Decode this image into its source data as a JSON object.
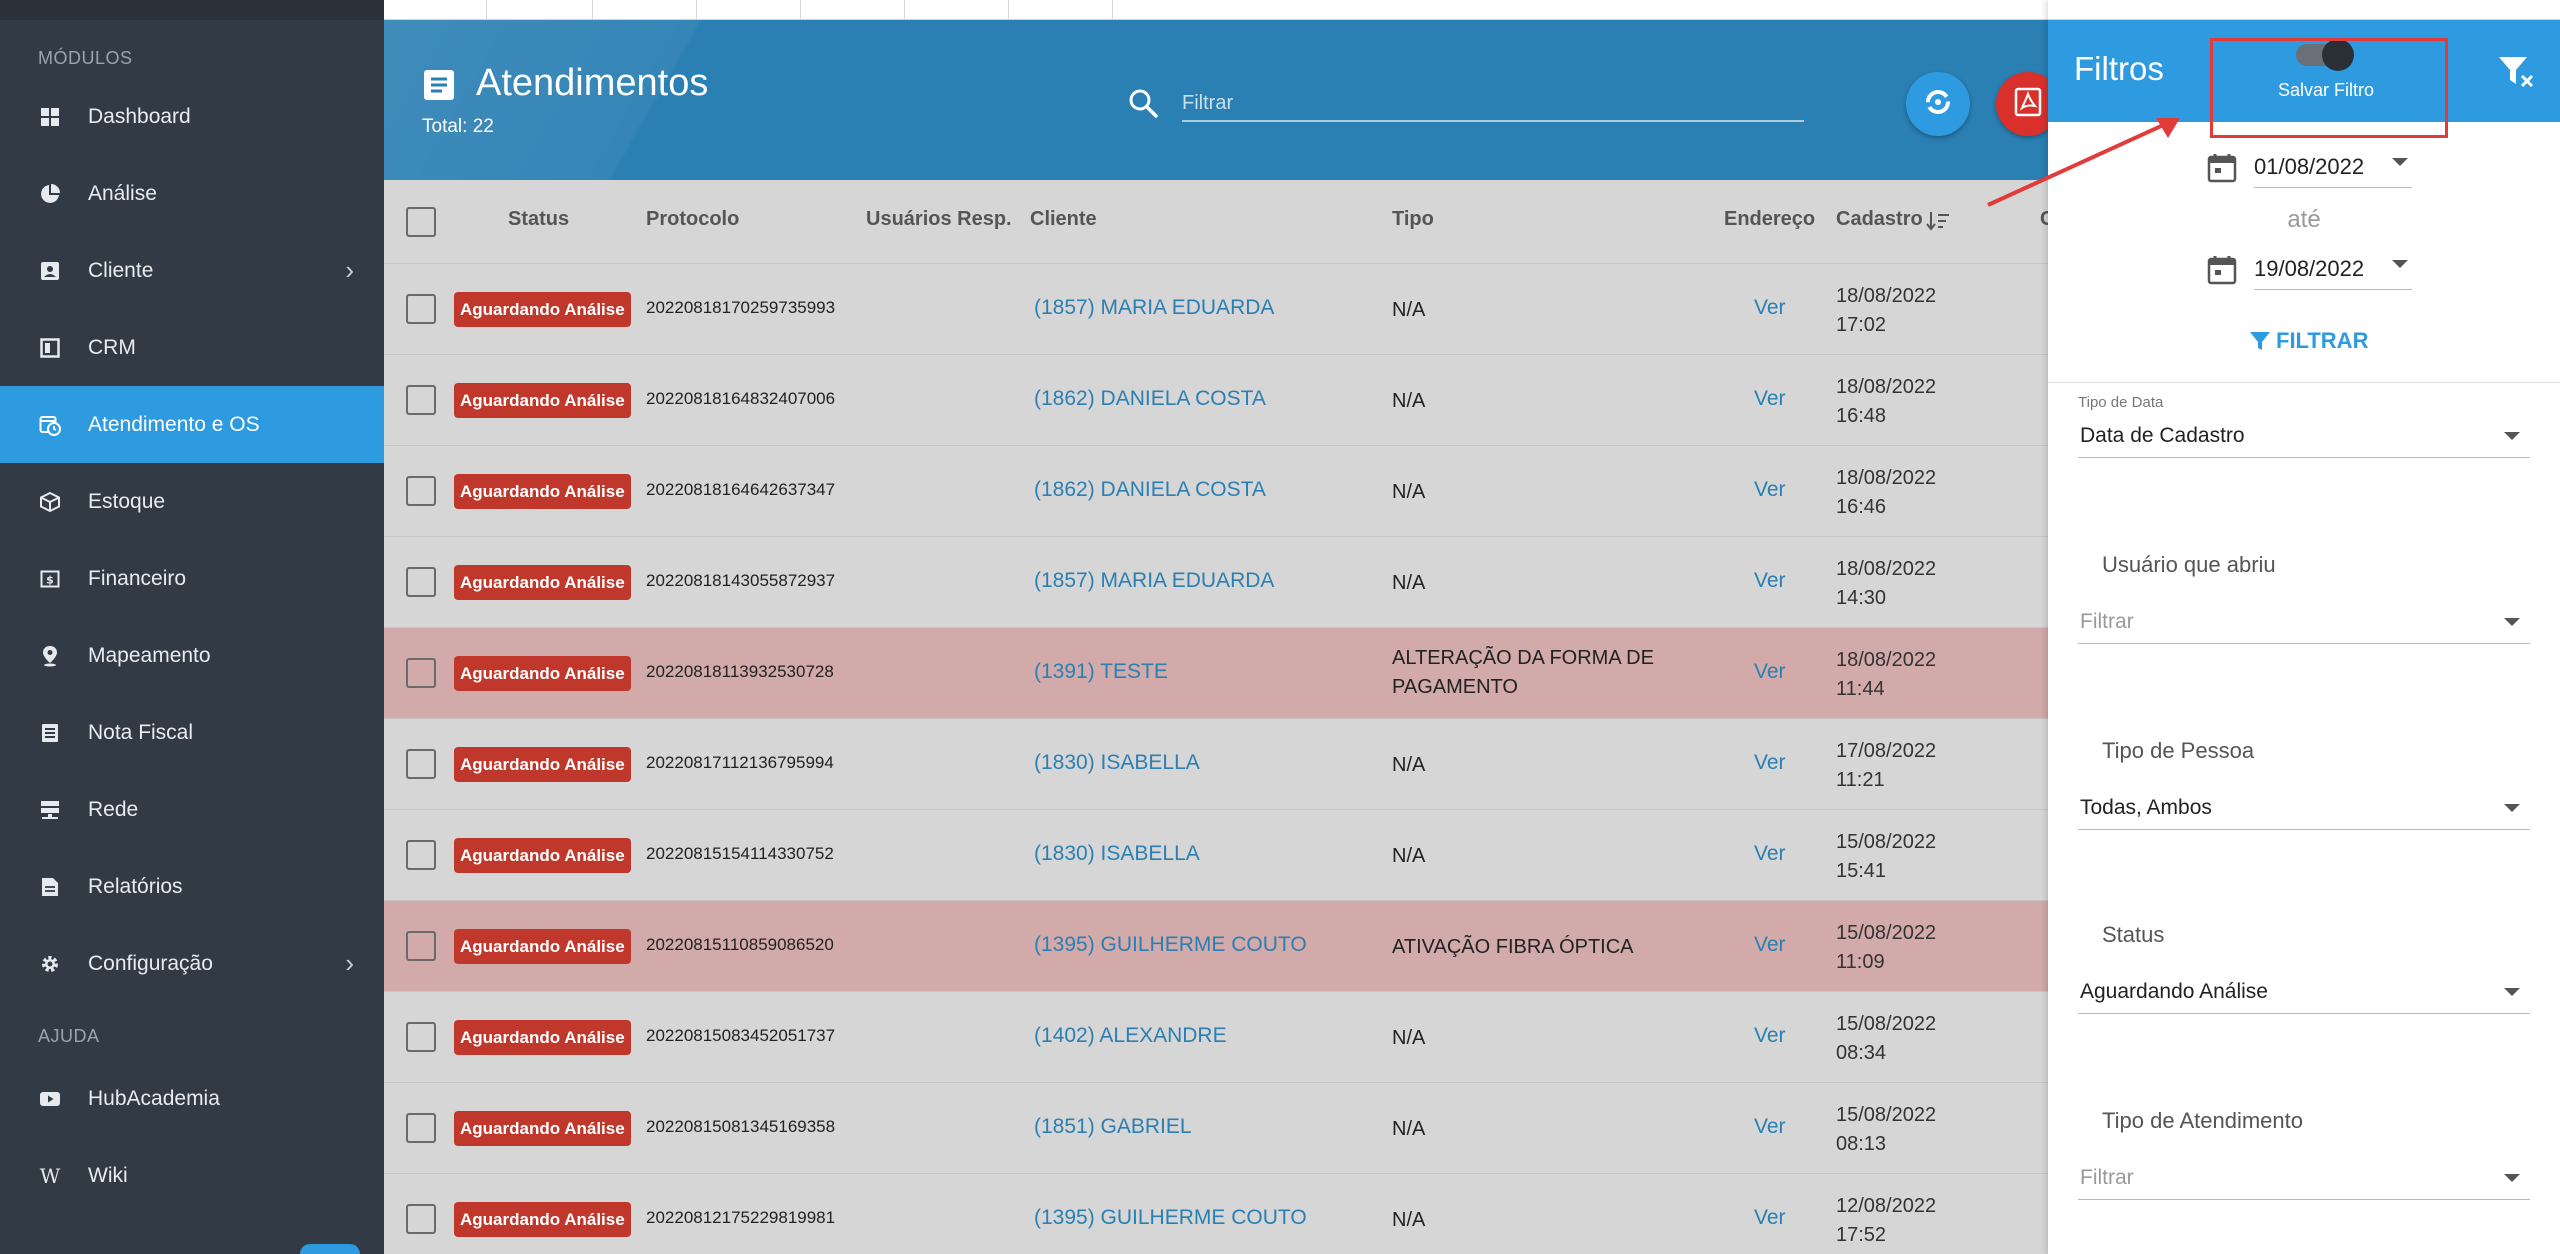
{
  "sidebar": {
    "section_modules": "MÓDULOS",
    "section_help": "AJUDA",
    "items": [
      {
        "label": "Dashboard",
        "icon": "dashboard-icon"
      },
      {
        "label": "Análise",
        "icon": "pie-chart-icon"
      },
      {
        "label": "Cliente",
        "icon": "contact-card-icon",
        "has_submenu": true
      },
      {
        "label": "CRM",
        "icon": "crm-board-icon"
      },
      {
        "label": "Atendimento e OS",
        "icon": "calendar-clock-icon",
        "active": true
      },
      {
        "label": "Estoque",
        "icon": "box-icon"
      },
      {
        "label": "Financeiro",
        "icon": "money-icon"
      },
      {
        "label": "Mapeamento",
        "icon": "map-pin-icon"
      },
      {
        "label": "Nota Fiscal",
        "icon": "receipt-icon"
      },
      {
        "label": "Rede",
        "icon": "server-icon"
      },
      {
        "label": "Relatórios",
        "icon": "report-icon"
      },
      {
        "label": "Configuração",
        "icon": "gear-icon",
        "has_submenu": true
      }
    ],
    "help_items": [
      {
        "label": "HubAcademia",
        "icon": "youtube-icon"
      },
      {
        "label": "Wiki",
        "icon": "wikipedia-icon"
      }
    ]
  },
  "header": {
    "title": "Atendimentos",
    "total": "Total: 22",
    "search_placeholder": "Filtrar",
    "bg_color": "#2a7fb3"
  },
  "table": {
    "columns": {
      "status": "Status",
      "protocolo": "Protocolo",
      "usuarios": "Usuários Resp.",
      "cliente": "Cliente",
      "tipo": "Tipo",
      "endereco": "Endereço",
      "cadastro": "Cadastro",
      "extra": "C"
    },
    "rows": [
      {
        "status": "Aguardando Análise",
        "protocolo": "20220818170259735993",
        "cliente": "(1857) MARIA EDUARDA",
        "tipo": "N/A",
        "endereco": "Ver",
        "date": "18/08/2022",
        "time": "17:02",
        "highlight": false
      },
      {
        "status": "Aguardando Análise",
        "protocolo": "20220818164832407006",
        "cliente": "(1862) DANIELA COSTA",
        "tipo": "N/A",
        "endereco": "Ver",
        "date": "18/08/2022",
        "time": "16:48",
        "highlight": false
      },
      {
        "status": "Aguardando Análise",
        "protocolo": "20220818164642637347",
        "cliente": "(1862) DANIELA COSTA",
        "tipo": "N/A",
        "endereco": "Ver",
        "date": "18/08/2022",
        "time": "16:46",
        "highlight": false
      },
      {
        "status": "Aguardando Análise",
        "protocolo": "20220818143055872937",
        "cliente": "(1857) MARIA EDUARDA",
        "tipo": "N/A",
        "endereco": "Ver",
        "date": "18/08/2022",
        "time": "14:30",
        "highlight": false
      },
      {
        "status": "Aguardando Análise",
        "protocolo": "20220818113932530728",
        "cliente": "(1391) TESTE",
        "tipo": "ALTERAÇÃO DA FORMA DE PAGAMENTO",
        "endereco": "Ver",
        "date": "18/08/2022",
        "time": "11:44",
        "highlight": true
      },
      {
        "status": "Aguardando Análise",
        "protocolo": "20220817112136795994",
        "cliente": "(1830) ISABELLA",
        "tipo": "N/A",
        "endereco": "Ver",
        "date": "17/08/2022",
        "time": "11:21",
        "highlight": false
      },
      {
        "status": "Aguardando Análise",
        "protocolo": "20220815154114330752",
        "cliente": "(1830) ISABELLA",
        "tipo": "N/A",
        "endereco": "Ver",
        "date": "15/08/2022",
        "time": "15:41",
        "highlight": false
      },
      {
        "status": "Aguardando Análise",
        "protocolo": "20220815110859086520",
        "cliente": "(1395) GUILHERME COUTO",
        "tipo": "ATIVAÇÃO FIBRA ÓPTICA",
        "endereco": "Ver",
        "date": "15/08/2022",
        "time": "11:09",
        "highlight": true
      },
      {
        "status": "Aguardando Análise",
        "protocolo": "20220815083452051737",
        "cliente": "(1402) ALEXANDRE",
        "tipo": "N/A",
        "endereco": "Ver",
        "date": "15/08/2022",
        "time": "08:34",
        "highlight": false
      },
      {
        "status": "Aguardando Análise",
        "protocolo": "20220815081345169358",
        "cliente": "(1851) GABRIEL",
        "tipo": "N/A",
        "endereco": "Ver",
        "date": "15/08/2022",
        "time": "08:13",
        "highlight": false
      },
      {
        "status": "Aguardando Análise",
        "protocolo": "20220812175229819981",
        "cliente": "(1395) GUILHERME COUTO",
        "tipo": "N/A",
        "endereco": "Ver",
        "date": "12/08/2022",
        "time": "17:52",
        "highlight": false
      }
    ]
  },
  "filters": {
    "title": "Filtros",
    "save_filter_label": "Salvar Filtro",
    "save_filter_on": true,
    "date_from": "01/08/2022",
    "date_sep": "até",
    "date_to": "19/08/2022",
    "apply_label": "FILTRAR",
    "tipo_data_label": "Tipo de Data",
    "tipo_data_value": "Data de Cadastro",
    "usuario_label": "Usuário que abriu",
    "usuario_placeholder": "Filtrar",
    "tipo_pessoa_label": "Tipo de Pessoa",
    "tipo_pessoa_value": "Todas, Ambos",
    "status_label": "Status",
    "status_value": "Aguardando Análise",
    "tipo_atendimento_label": "Tipo de Atendimento",
    "tipo_atendimento_placeholder": "Filtrar",
    "accent_color": "#2e9be0",
    "highlight_color": "#e23b3b"
  }
}
